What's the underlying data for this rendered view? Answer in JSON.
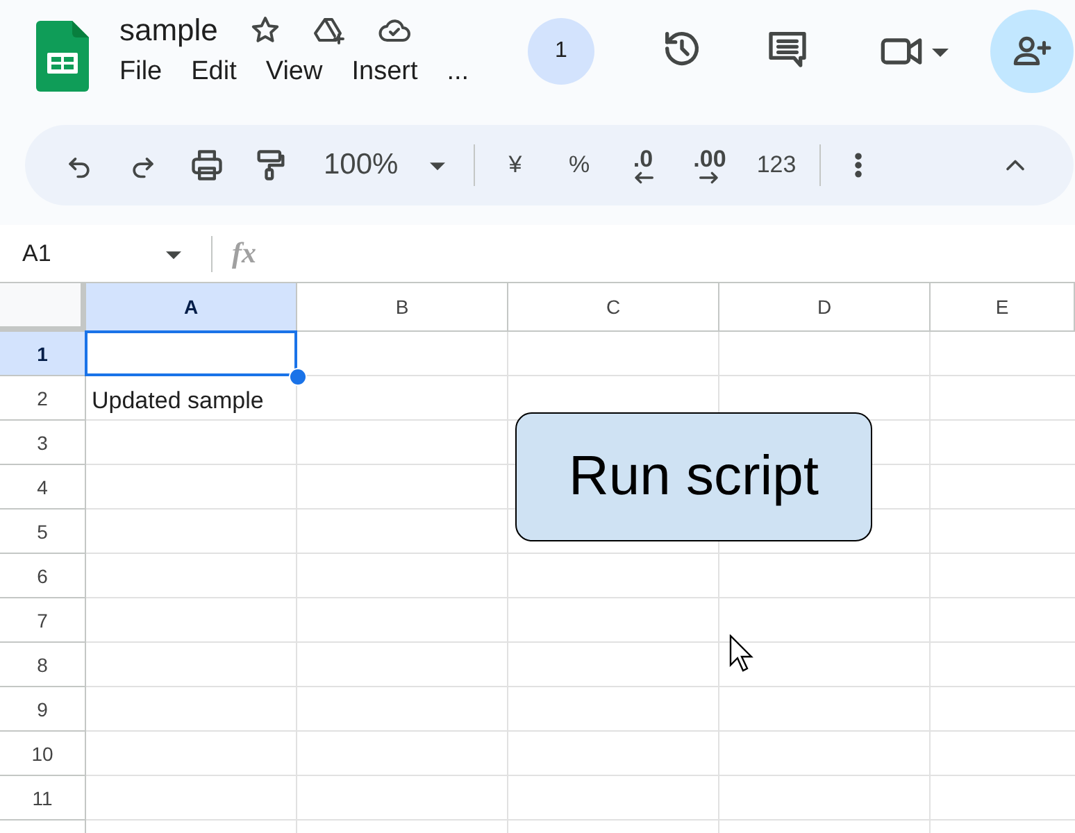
{
  "document": {
    "title": "sample",
    "menu": [
      "File",
      "Edit",
      "View",
      "Insert",
      "..."
    ]
  },
  "collaborators": {
    "count": "1"
  },
  "toolbar": {
    "zoom": "100%",
    "currency": "¥",
    "percent": "%",
    "decrease_decimals": ".0",
    "increase_decimals": ".00",
    "number_format": "123"
  },
  "formula_bar": {
    "name_box": "A1",
    "function_label": "fx"
  },
  "columns": [
    {
      "label": "A",
      "selected": true
    },
    {
      "label": "B",
      "selected": false
    },
    {
      "label": "C",
      "selected": false
    },
    {
      "label": "D",
      "selected": false
    },
    {
      "label": "E",
      "selected": false
    }
  ],
  "rows": [
    {
      "label": "1",
      "selected": true,
      "cells": [
        {
          "text": "",
          "active": true
        }
      ]
    },
    {
      "label": "2",
      "selected": false,
      "cells": [
        {
          "text": "Updated sample",
          "active": false
        }
      ]
    },
    {
      "label": "3",
      "selected": false,
      "cells": []
    },
    {
      "label": "4",
      "selected": false,
      "cells": []
    },
    {
      "label": "5",
      "selected": false,
      "cells": []
    },
    {
      "label": "6",
      "selected": false,
      "cells": []
    },
    {
      "label": "7",
      "selected": false,
      "cells": []
    },
    {
      "label": "8",
      "selected": false,
      "cells": []
    },
    {
      "label": "9",
      "selected": false,
      "cells": []
    },
    {
      "label": "10",
      "selected": false,
      "cells": []
    },
    {
      "label": "11",
      "selected": false,
      "cells": []
    }
  ],
  "drawing_button": {
    "label": "Run script"
  }
}
